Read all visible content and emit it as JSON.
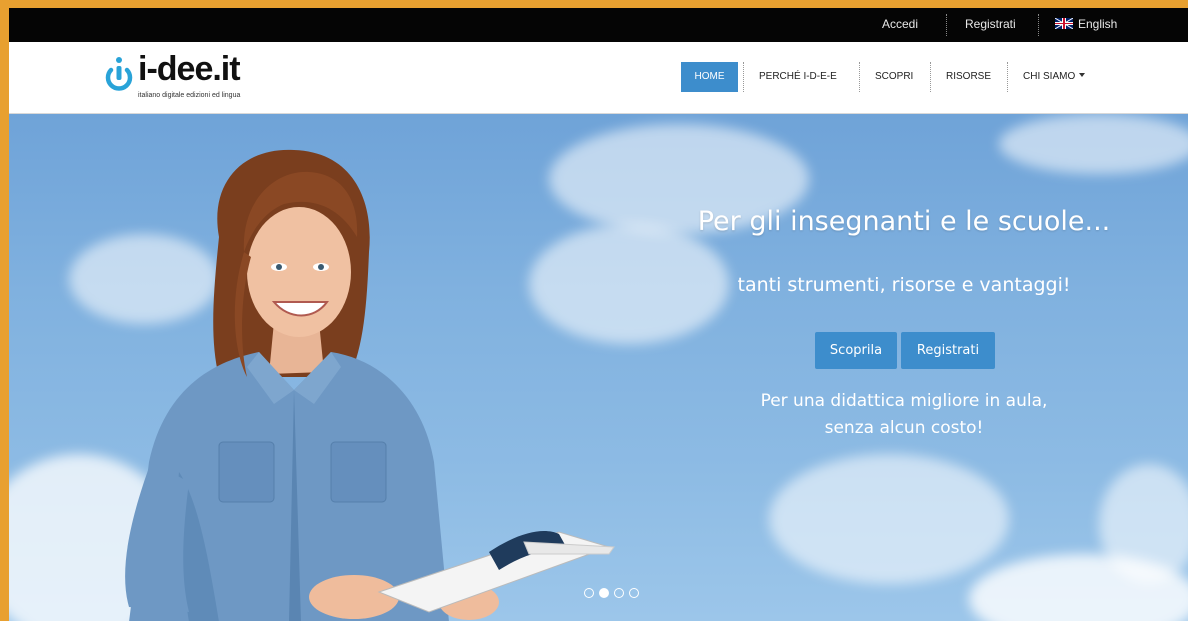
{
  "topbar": {
    "login": "Accedi",
    "register": "Registrati",
    "language": "English"
  },
  "brand": {
    "name": "i-dee.it",
    "tagline": "italiano digitale edizioni ed lingua"
  },
  "nav": {
    "home": "HOME",
    "why": "PERCHÉ I-D-E-E",
    "discover": "SCOPRI",
    "resources": "RISORSE",
    "about": "CHI SIAMO"
  },
  "hero": {
    "headline": "Per gli insegnanti e le scuole...",
    "subline": "tanti strumenti, risorse e vantaggi!",
    "btn_discover": "Scoprila",
    "btn_register": "Registrati",
    "tagline_1": "Per una didattica migliore in aula,",
    "tagline_2": "senza alcun costo!"
  },
  "carousel": {
    "slides": 4,
    "active": 2
  },
  "colors": {
    "accent": "#3d8dcc",
    "frame": "#e8a030",
    "topbar": "#050505"
  }
}
